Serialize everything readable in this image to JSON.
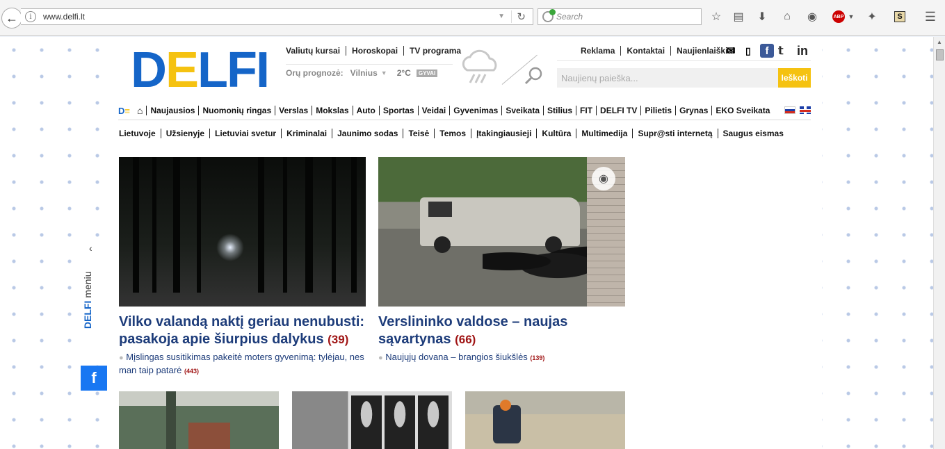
{
  "browser": {
    "url": "www.delfi.lt",
    "search_placeholder": "Search",
    "abp_label": "ABP",
    "s_label": "S"
  },
  "header": {
    "logo": {
      "d": "D",
      "e": "E",
      "rest": "LFI"
    },
    "top_links": [
      "Valiutų kursai",
      "Horoskopai",
      "TV programa"
    ],
    "weather": {
      "label": "Orų prognozė:",
      "city": "Vilnius",
      "temp": "2°C",
      "live": "GYVAI"
    },
    "right_links": [
      "Reklama",
      "Kontaktai",
      "Naujienlaiškiai"
    ],
    "search_placeholder": "Naujienų paieška...",
    "search_button": "Ieškoti"
  },
  "main_nav": {
    "de_label": "D",
    "items": [
      "Naujausios",
      "Nuomonių ringas",
      "Verslas",
      "Mokslas",
      "Auto",
      "Sportas",
      "Veidai",
      "Gyvenimas",
      "Sveikata",
      "Stilius",
      "FIT",
      "DELFI TV",
      "Pilietis",
      "Grynas",
      "EKO Sveikata"
    ]
  },
  "sub_nav": {
    "items": [
      "Lietuvoje",
      "Užsienyje",
      "Lietuviai svetur",
      "Kriminalai",
      "Jaunimo sodas",
      "Teisė",
      "Temos",
      "Įtakingiausieji",
      "Kultūra",
      "Multimedija",
      "Supr@sti internetą",
      "Saugus eismas"
    ]
  },
  "articles": [
    {
      "title": "Vilko valandą naktį geriau nenubusti: pasakoja apie šiurpius dalykus",
      "count": "(39)",
      "related": "Mįslingas susitikimas pakeitė moters gyvenimą: tylėjau, nes man taip patarė",
      "related_count": "(443)"
    },
    {
      "title": "Verslininko valdose – naujas sąvartynas",
      "count": "(66)",
      "related": "Naujųjų dovana – brangios šiukšlės",
      "related_count": "(139)"
    }
  ],
  "side_menu": {
    "brand": "DELFI",
    "label": "meniu",
    "fb": "f"
  },
  "colors": {
    "brand_blue": "#1565c8",
    "brand_yellow": "#f5c211",
    "headline": "#1d3c7a",
    "count_red": "#a01515"
  }
}
